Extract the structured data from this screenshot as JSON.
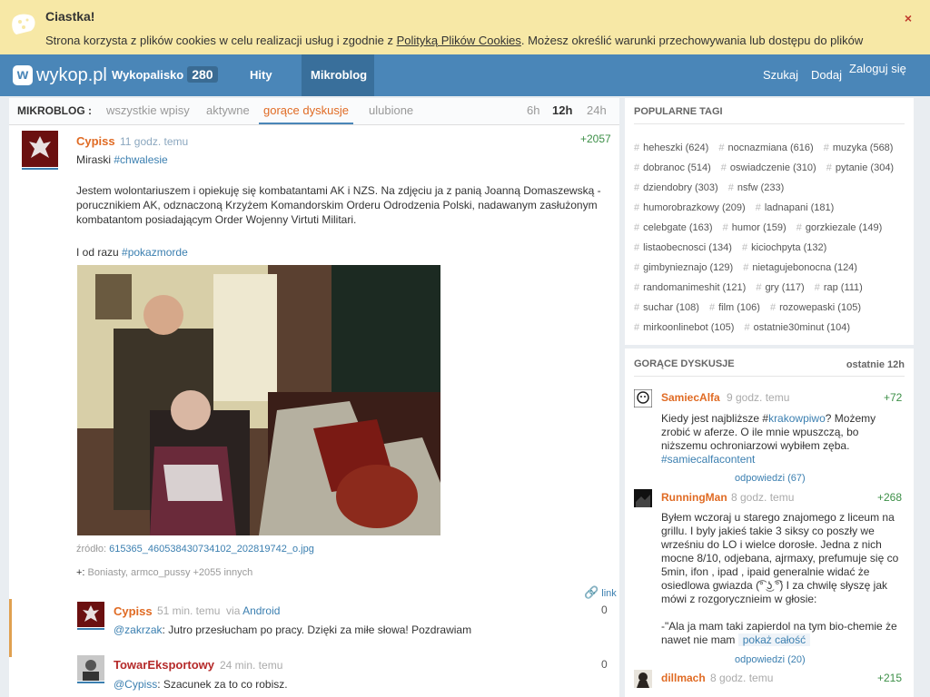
{
  "cookie": {
    "title": "Ciastka!",
    "text_before": "Strona korzysta z plików cookies w celu realizacji usług i zgodnie z ",
    "policy_link": "Polityką Plików Cookies",
    "text_after": ". Możesz określić warunki przechowywania lub dostępu do plików",
    "close": "×"
  },
  "nav": {
    "logo": "wykop.pl",
    "wykopalisko": "Wykopalisko",
    "wykopalisko_count": "280",
    "hity": "Hity",
    "mikroblog": "Mikroblog",
    "szukaj": "Szukaj",
    "dodaj": "Dodaj",
    "zaloguj": "Zaloguj się"
  },
  "filter": {
    "label": "MIKROBLOG :",
    "tabs": [
      "wszystkie wpisy",
      "aktywne",
      "gorące dyskusje",
      "ulubione"
    ],
    "times": [
      "6h",
      "12h",
      "24h"
    ]
  },
  "entry": {
    "author": "Cypiss",
    "time": "11 godz. temu",
    "votes": "+2057",
    "line1_prefix": "Miraski ",
    "line1_tag": "#chwalesie",
    "paragraph": "Jestem wolontariuszem i opiekuję się kombatantami AK i NZS. Na zdjęciu ja z panią Joanną Domaszewską - porucznikiem AK, odznaczoną Krzyżem Komandorskim Orderu Odrodzenia Polski, nadawanym zasłużonym kombatantom posiadającym Order Wojenny Virtuti Militari.",
    "line3_prefix": "I od razu ",
    "line3_tag": "#pokazmorde",
    "source_label": "źródło: ",
    "source_file": "615365_460538430734102_202819742_o.jpg",
    "plus_label": "+: ",
    "plus_users": "Boniasty, armco_pussy +2055 innych",
    "link_label": "link"
  },
  "replies": [
    {
      "author": "Cypiss",
      "time": "51 min. temu",
      "via_label": "via ",
      "via": "Android",
      "votes": "0",
      "mention": "@zakrzak",
      "text": ": Jutro przesłucham po pracy. Dzięki za miłe słowa! Pozdrawiam"
    },
    {
      "author": "TowarEksportowy",
      "time": "24 min. temu",
      "votes": "0",
      "mention": "@Cypiss",
      "text": ": Szacunek za to co robisz."
    }
  ],
  "popular_tags": {
    "title": "POPULARNE TAGI",
    "tags": [
      "heheszki (624)",
      "nocnazmiana (616)",
      "muzyka (568)",
      "dobranoc (514)",
      "oswiadczenie (310)",
      "pytanie (304)",
      "dziendobry (303)",
      "nsfw (233)",
      "humorobrazkowy (209)",
      "ladnapani (181)",
      "celebgate (163)",
      "humor (159)",
      "gorzkiezale (149)",
      "listaobecnosci (134)",
      "kiciochpyta (132)",
      "gimbynieznajo (129)",
      "nietagujebonocna (124)",
      "randomanimeshit (121)",
      "gry (117)",
      "rap (111)",
      "suchar (108)",
      "film (106)",
      "rozowepaski (105)",
      "mirkoonlinebot (105)",
      "ostatnie30minut (104)"
    ]
  },
  "hot": {
    "title": "GORĄCE DYSKUSJE",
    "period": "ostatnie 12h",
    "items": [
      {
        "author": "SamiecAlfa",
        "time": "9 godz. temu",
        "votes": "+72",
        "text_a": "Kiedy jest najbliższe #",
        "tag_a": "krakowpiwo",
        "text_b": "? Możemy zrobić w aferze. O ile mnie wpuszczą, bo niższemu ochroniarzowi wybiłem zęba.",
        "tag_b": "#samiecalfacontent",
        "replies": "odpowiedzi (67)"
      },
      {
        "author": "RunningMan",
        "time": "8 godz. temu",
        "votes": "+268",
        "text": "Byłem wczoraj u starego znajomego z liceum na grillu. I byly jakieś takie 3 siksy co poszły we wrześniu do LO i wielce dorosłe. Jedna z nich mocne 8/10, odjebana, ajrmaxy, prefumuje się co 5min, ifon , ipad , ipaid generalnie widać że osiedlowa gwiazda (͡° ͜ʖ ͡°) I za chwilę słyszę jak mówi z rozgorycznieim w głosie:",
        "text2": "-\"Ala ja mam taki zapierdol na tym bio-chemie że nawet nie mam",
        "show_more": "pokaż całość",
        "replies": "odpowiedzi (20)"
      },
      {
        "author": "dillmach",
        "time": "8 godz. temu",
        "votes": "+215"
      }
    ]
  }
}
